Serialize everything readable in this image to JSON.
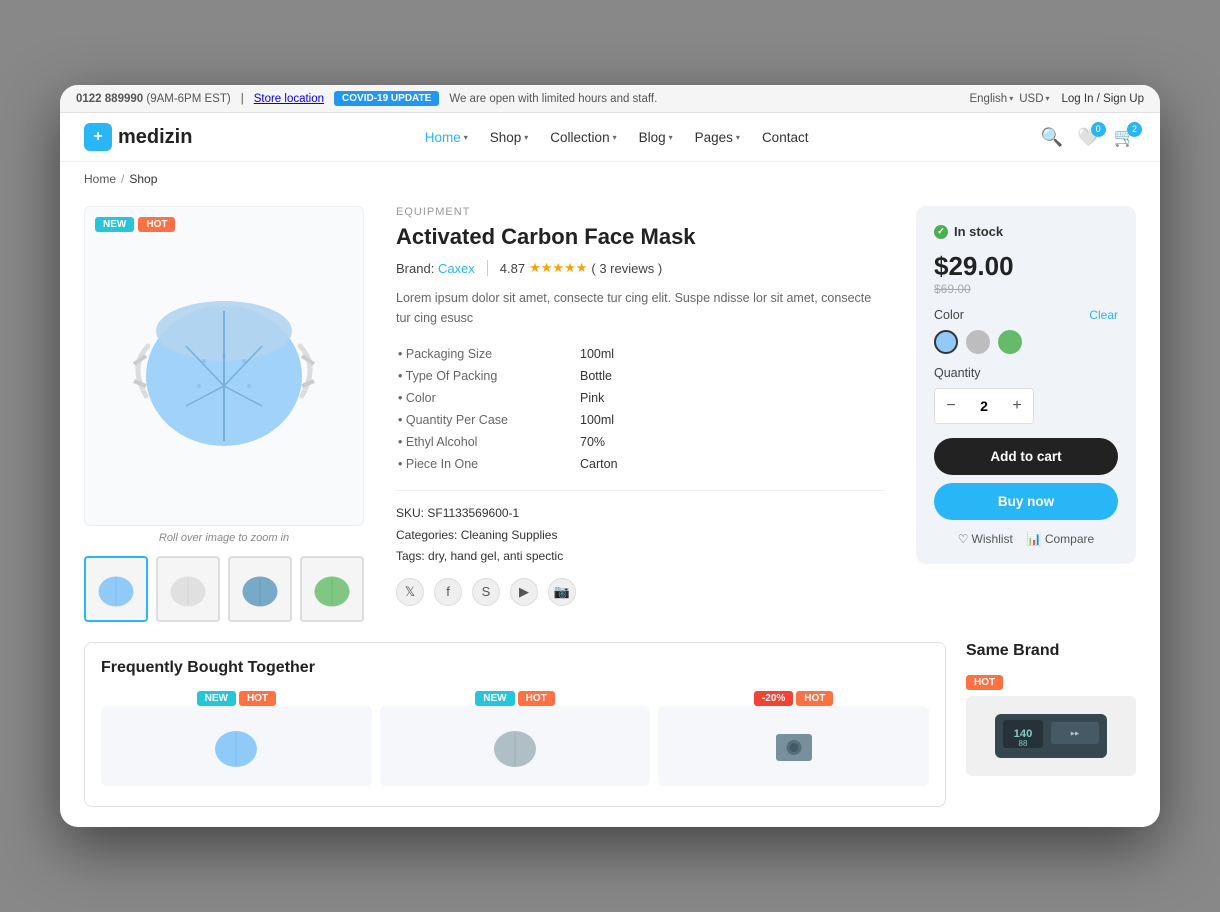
{
  "topbar": {
    "phone": "0122 889990",
    "hours": "(9AM-6PM EST)",
    "store_location": "Store location",
    "covid_badge": "COVID-19 UPDATE",
    "covid_msg": "We are open with limited hours and staff.",
    "language": "English",
    "currency": "USD",
    "login": "Log In / Sign Up"
  },
  "nav": {
    "logo_text": "medizin",
    "links": [
      {
        "label": "Home",
        "active": true
      },
      {
        "label": "Shop",
        "active": false
      },
      {
        "label": "Collection",
        "active": false
      },
      {
        "label": "Blog",
        "active": false
      },
      {
        "label": "Pages",
        "active": false
      },
      {
        "label": "Contact",
        "active": false
      }
    ],
    "wishlist_count": "0",
    "cart_count": "2"
  },
  "breadcrumb": {
    "home": "Home",
    "shop": "Shop"
  },
  "product": {
    "equipment_label": "EQUIPMENT",
    "title": "Activated Carbon Face Mask",
    "brand_label": "Brand:",
    "brand_name": "Caxex",
    "rating": "4.87",
    "reviews": "( 3 reviews )",
    "description": "Lorem ipsum dolor sit amet, consecte tur cing elit. Suspe ndisse lor sit amet, consecte tur cing esusc",
    "specs": [
      {
        "label": "Packaging Size",
        "value": "100ml"
      },
      {
        "label": "Type Of Packing",
        "value": "Bottle"
      },
      {
        "label": "Color",
        "value": "Pink"
      },
      {
        "label": "Quantity Per Case",
        "value": "100ml"
      },
      {
        "label": "Ethyl Alcohol",
        "value": "70%"
      },
      {
        "label": "Piece In One",
        "value": "Carton"
      }
    ],
    "sku_label": "SKU:",
    "sku": "SF1133569600-1",
    "categories_label": "Categories:",
    "categories": "Cleaning Supplies",
    "tags_label": "Tags:",
    "tags": "dry, hand gel, anti spectic",
    "zoom_hint": "Roll over image to zoom in",
    "badges": {
      "new": "NEW",
      "hot": "HOT"
    }
  },
  "sidebar": {
    "in_stock": "In stock",
    "price": "$29.00",
    "old_price": "$69.00",
    "color_label": "Color",
    "clear_label": "Clear",
    "quantity_label": "Quantity",
    "qty_value": "2",
    "qty_minus": "−",
    "qty_plus": "+",
    "add_cart": "Add to cart",
    "buy_now": "Buy now",
    "wishlist": "Wishlist",
    "compare": "Compare"
  },
  "bottom": {
    "fbt_title": "Frequently Bought Together",
    "same_brand_title": "Same Brand",
    "fbt_badges": [
      {
        "new": "NEW",
        "hot": "HOT"
      },
      {
        "new": "NEW",
        "hot": "HOT"
      },
      {
        "discount": "-20%",
        "hot": "HOT"
      }
    ]
  }
}
